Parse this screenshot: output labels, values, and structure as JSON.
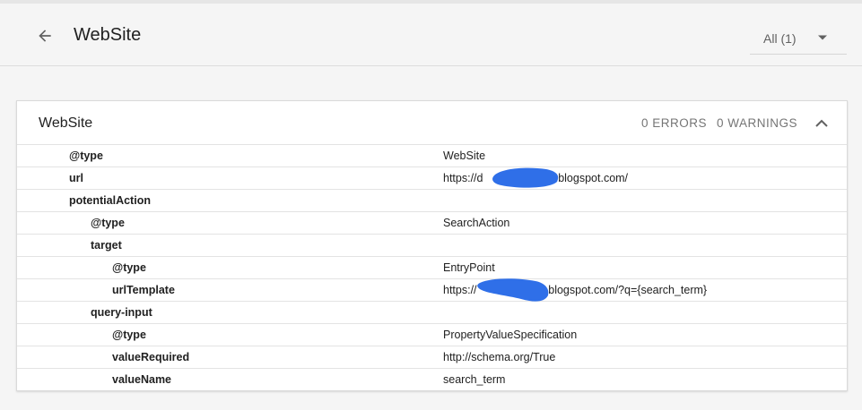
{
  "header": {
    "title": "WebSite",
    "filter_label": "All (1)"
  },
  "card": {
    "title": "WebSite",
    "errors": "0 ERRORS",
    "warnings": "0 WARNINGS"
  },
  "rows": [
    {
      "key": "@type",
      "value": "WebSite"
    },
    {
      "key": "url",
      "value": "https://d",
      "value_suffix": "s.blogspot.com/"
    },
    {
      "key": "potentialAction",
      "value": ""
    },
    {
      "key": "@type",
      "value": "SearchAction"
    },
    {
      "key": "target",
      "value": ""
    },
    {
      "key": "@type",
      "value": "EntryPoint"
    },
    {
      "key": "urlTemplate",
      "value": "https://",
      "value_suffix": "s.blogspot.com/?q={search_term}"
    },
    {
      "key": "query-input",
      "value": ""
    },
    {
      "key": "@type",
      "value": "PropertyValueSpecification"
    },
    {
      "key": "valueRequired",
      "value": "http://schema.org/True"
    },
    {
      "key": "valueName",
      "value": "search_term"
    }
  ],
  "colors": {
    "redaction": "#2f6fe8",
    "background": "#f5f5f5",
    "muted_text": "#757575"
  }
}
